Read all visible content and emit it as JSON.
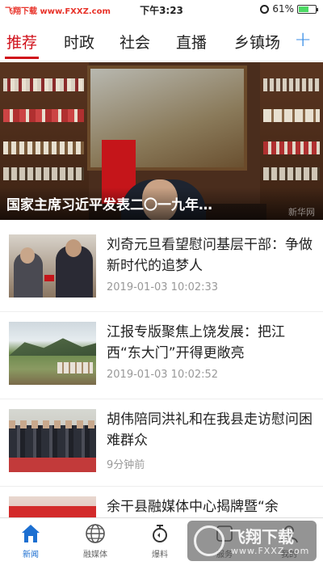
{
  "status_bar": {
    "carrier": "飞翔下载 www.FXXZ.com",
    "time": "下午3:23",
    "battery": "61%",
    "battery_level": 0.61
  },
  "tabs": [
    {
      "label": "推荐",
      "active": true
    },
    {
      "label": "时政",
      "active": false
    },
    {
      "label": "社会",
      "active": false
    },
    {
      "label": "直播",
      "active": false
    },
    {
      "label": "乡镇场",
      "active": false
    }
  ],
  "tabs_add": "+",
  "hero": {
    "caption": "国家主席习近平发表二〇一九年…",
    "watermark": "新华网"
  },
  "articles": [
    {
      "title": "刘奇元旦看望慰问基层干部：争做新时代的追梦人",
      "time": "2019-01-03 10:02:33"
    },
    {
      "title": "江报专版聚焦上饶发展：把江西“东大门”开得更敞亮",
      "time": "2019-01-03 10:02:52"
    },
    {
      "title": "胡伟陪同洪礼和在我县走访慰问困难群众",
      "time": "9分钟前"
    },
    {
      "title": "余干县融媒体中心揭牌暨“余",
      "time": ""
    }
  ],
  "tabbar": [
    {
      "label": "新闻",
      "icon": "home-icon",
      "active": true
    },
    {
      "label": "融媒体",
      "icon": "globe-icon",
      "active": false
    },
    {
      "label": "爆料",
      "icon": "broadcast-icon",
      "active": false
    },
    {
      "label": "服务",
      "icon": "service-icon",
      "active": false
    },
    {
      "label": "我的",
      "icon": "user-icon",
      "active": false
    }
  ],
  "watermark": {
    "brand": "飞翔下载",
    "url": "www.FXXZ.com"
  }
}
